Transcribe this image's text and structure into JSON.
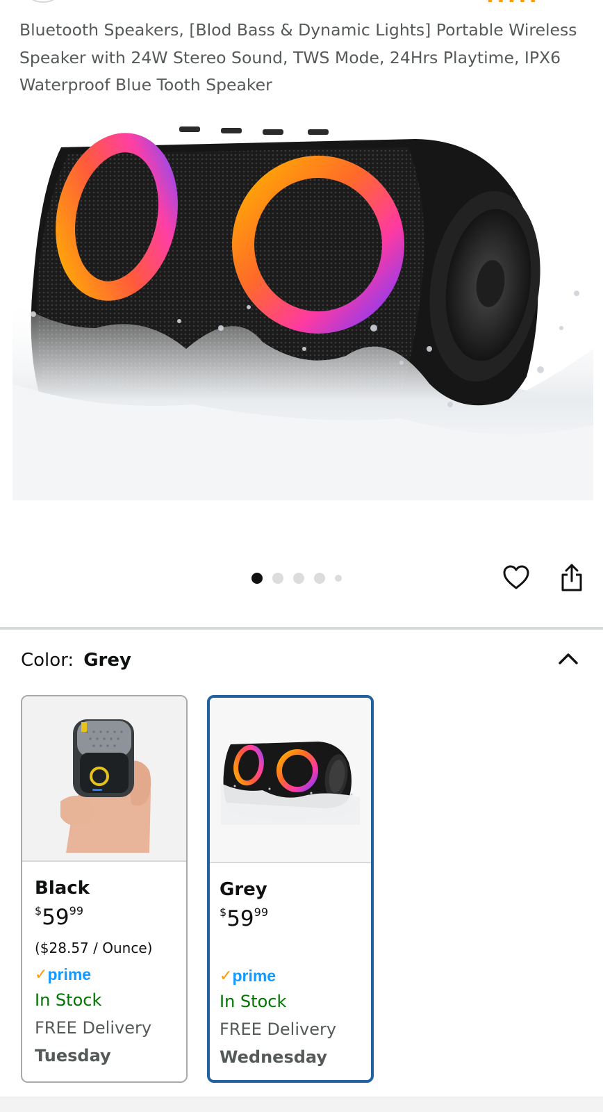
{
  "product": {
    "title": "Bluetooth Speakers, [Blod Bass & Dynamic Lights] Portable Wireless Speaker with 24W Stereo Sound, TWS Mode, 24Hrs Playtime, IPX6 Waterproof Blue Tooth Speaker"
  },
  "gallery": {
    "image_count": 5,
    "active_index": 0
  },
  "actions": {
    "wishlist_icon": "heart-outline-icon",
    "share_icon": "share-icon"
  },
  "color_selector": {
    "label": "Color:",
    "selected": "Grey",
    "collapse_icon": "chevron-up-icon"
  },
  "swatches": [
    {
      "name": "Black",
      "price_symbol": "$",
      "price_whole": "59",
      "price_cents": "99",
      "unit_price": "($28.57 / Ounce)",
      "prime_check": "✓",
      "prime": "prime",
      "stock": "In Stock",
      "delivery": "FREE Delivery",
      "day": "Tuesday",
      "selected": false
    },
    {
      "name": "Grey",
      "price_symbol": "$",
      "price_whole": "59",
      "price_cents": "99",
      "unit_price": "",
      "prime_check": "✓",
      "prime": "prime",
      "stock": "In Stock",
      "delivery": "FREE Delivery",
      "day": "Wednesday",
      "selected": true
    }
  ],
  "colors": {
    "selected_border": "#2162a1",
    "prime_blue": "#1399ff",
    "prime_check": "#ff9900",
    "in_stock": "#007600",
    "muted_text": "#565959"
  }
}
